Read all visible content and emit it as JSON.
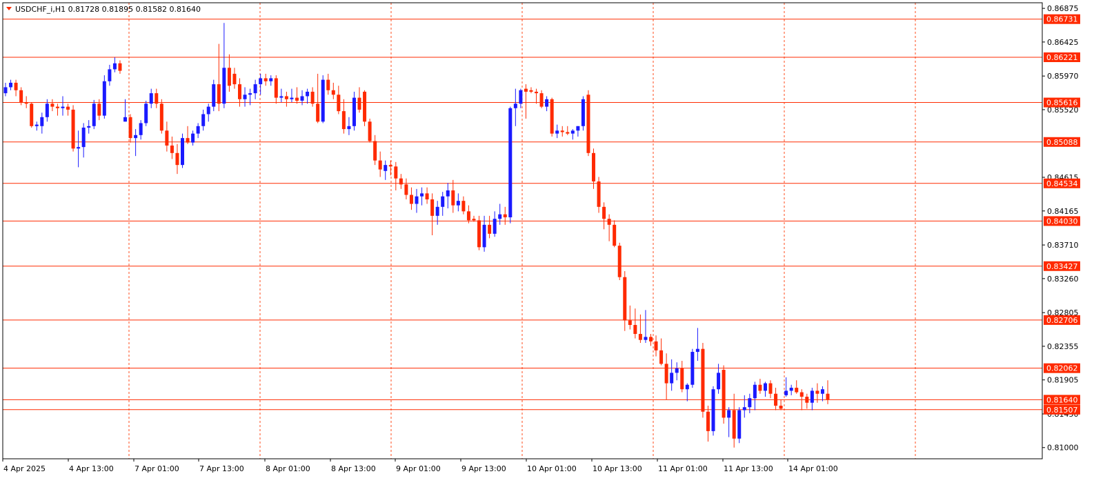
{
  "chart_header": {
    "symbol": "USDCHF_i,H1",
    "ohlc": "0.81728 0.81895 0.81582 0.81640",
    "text": "USDCHF_i,H1  0.81728 0.81895 0.81582 0.81640"
  },
  "colors": {
    "bull": "#1a1aff",
    "bear": "#ff2a00",
    "hline": "#ff2a00",
    "vgrid": "#ff4a1a",
    "label_bg": "#ff2a00",
    "label_text": "#ffffff",
    "frame": "#000000"
  },
  "chart_data": {
    "type": "candlestick",
    "title": "USDCHF_i,H1",
    "ylim": [
      0.8085,
      0.8695
    ],
    "price_axis_ticks": [
      "0.86875",
      "0.86425",
      "0.85970",
      "0.85520",
      "0.84615",
      "0.84165",
      "0.83710",
      "0.83260",
      "0.82805",
      "0.82355",
      "0.81905",
      "0.81450",
      "0.81000"
    ],
    "time_axis_ticks": [
      "4 Apr 2025",
      "4 Apr 13:00",
      "7 Apr 01:00",
      "7 Apr 13:00",
      "8 Apr 01:00",
      "8 Apr 13:00",
      "9 Apr 01:00",
      "9 Apr 13:00",
      "10 Apr 01:00",
      "10 Apr 13:00",
      "11 Apr 01:00",
      "11 Apr 13:00",
      "14 Apr 01:00"
    ],
    "horizontal_levels": [
      "0.86731",
      "0.86221",
      "0.85616",
      "0.85088",
      "0.84534",
      "0.84030",
      "0.83427",
      "0.82706",
      "0.82062",
      "0.81640",
      "0.81507"
    ],
    "current_price": "0.81640",
    "candles": [
      [
        0.8574,
        0.8588,
        0.857,
        0.8582
      ],
      [
        0.8582,
        0.8592,
        0.8578,
        0.8588
      ],
      [
        0.8588,
        0.8592,
        0.857,
        0.8578
      ],
      [
        0.8578,
        0.8582,
        0.8558,
        0.8562
      ],
      [
        0.8562,
        0.857,
        0.8554,
        0.856
      ],
      [
        0.856,
        0.8562,
        0.8528,
        0.853
      ],
      [
        0.853,
        0.8536,
        0.8524,
        0.8532
      ],
      [
        0.853,
        0.8548,
        0.852,
        0.8542
      ],
      [
        0.8542,
        0.8566,
        0.8536,
        0.856
      ],
      [
        0.856,
        0.8566,
        0.855,
        0.8556
      ],
      [
        0.8556,
        0.856,
        0.8544,
        0.8554
      ],
      [
        0.8554,
        0.857,
        0.8544,
        0.8556
      ],
      [
        0.8556,
        0.856,
        0.8544,
        0.8552
      ],
      [
        0.8552,
        0.8558,
        0.8496,
        0.85
      ],
      [
        0.85,
        0.8524,
        0.8475,
        0.8502
      ],
      [
        0.8502,
        0.8534,
        0.8488,
        0.8528
      ],
      [
        0.8528,
        0.8538,
        0.852,
        0.853
      ],
      [
        0.853,
        0.8565,
        0.8526,
        0.856
      ],
      [
        0.856,
        0.8566,
        0.8538,
        0.8544
      ],
      [
        0.8544,
        0.8598,
        0.854,
        0.859
      ],
      [
        0.859,
        0.8612,
        0.8584,
        0.8606
      ],
      [
        0.8606,
        0.8622,
        0.8602,
        0.8614
      ],
      [
        0.8614,
        0.8618,
        0.86,
        0.8604
      ],
      [
        0.8536,
        0.8566,
        0.8536,
        0.8542
      ],
      [
        0.8542,
        0.8546,
        0.8508,
        0.8514
      ],
      [
        0.8514,
        0.8526,
        0.849,
        0.8518
      ],
      [
        0.8518,
        0.8538,
        0.8512,
        0.8534
      ],
      [
        0.8534,
        0.8564,
        0.853,
        0.856
      ],
      [
        0.856,
        0.858,
        0.8554,
        0.8574
      ],
      [
        0.8574,
        0.858,
        0.8554,
        0.856
      ],
      [
        0.856,
        0.8566,
        0.852,
        0.8524
      ],
      [
        0.8524,
        0.8536,
        0.8496,
        0.8504
      ],
      [
        0.8504,
        0.8516,
        0.8486,
        0.8494
      ],
      [
        0.8494,
        0.8506,
        0.8466,
        0.8478
      ],
      [
        0.8478,
        0.852,
        0.8474,
        0.8514
      ],
      [
        0.8514,
        0.853,
        0.8506,
        0.8508
      ],
      [
        0.8508,
        0.8524,
        0.8504,
        0.852
      ],
      [
        0.852,
        0.8534,
        0.8514,
        0.853
      ],
      [
        0.853,
        0.8552,
        0.8524,
        0.8546
      ],
      [
        0.8546,
        0.856,
        0.8536,
        0.8556
      ],
      [
        0.8556,
        0.8592,
        0.855,
        0.8586
      ],
      [
        0.8586,
        0.864,
        0.855,
        0.856
      ],
      [
        0.856,
        0.8668,
        0.8554,
        0.8608
      ],
      [
        0.8608,
        0.8626,
        0.8576,
        0.8584
      ],
      [
        0.86,
        0.8608,
        0.858,
        0.8586
      ],
      [
        0.8586,
        0.8594,
        0.8556,
        0.8566
      ],
      [
        0.8566,
        0.8582,
        0.8556,
        0.8572
      ],
      [
        0.8572,
        0.858,
        0.8558,
        0.8574
      ],
      [
        0.8574,
        0.8592,
        0.8566,
        0.8586
      ],
      [
        0.8586,
        0.86,
        0.8572,
        0.8594
      ],
      [
        0.8594,
        0.86,
        0.8584,
        0.859
      ],
      [
        0.859,
        0.8598,
        0.8584,
        0.8594
      ],
      [
        0.8594,
        0.8598,
        0.856,
        0.8568
      ],
      [
        0.8568,
        0.858,
        0.8562,
        0.857
      ],
      [
        0.857,
        0.8576,
        0.8556,
        0.8566
      ],
      [
        0.8566,
        0.858,
        0.8562,
        0.8568
      ],
      [
        0.8568,
        0.8582,
        0.856,
        0.8564
      ],
      [
        0.8564,
        0.8578,
        0.8558,
        0.857
      ],
      [
        0.857,
        0.858,
        0.856,
        0.8576
      ],
      [
        0.8576,
        0.8582,
        0.8556,
        0.856
      ],
      [
        0.856,
        0.86,
        0.8534,
        0.8536
      ],
      [
        0.8536,
        0.8598,
        0.8534,
        0.8592
      ],
      [
        0.8592,
        0.86,
        0.8572,
        0.8578
      ],
      [
        0.8578,
        0.8588,
        0.8566,
        0.8572
      ],
      [
        0.8572,
        0.8584,
        0.8546,
        0.855
      ],
      [
        0.855,
        0.8566,
        0.852,
        0.8526
      ],
      [
        0.8526,
        0.8542,
        0.8518,
        0.853
      ],
      [
        0.853,
        0.8576,
        0.8524,
        0.8568
      ],
      [
        0.8568,
        0.8582,
        0.8548,
        0.8552
      ],
      [
        0.8576,
        0.8578,
        0.853,
        0.8536
      ],
      [
        0.8536,
        0.854,
        0.8508,
        0.851
      ],
      [
        0.851,
        0.8518,
        0.8478,
        0.8484
      ],
      [
        0.8484,
        0.8496,
        0.8462,
        0.8472
      ],
      [
        0.847,
        0.8484,
        0.8458,
        0.8478
      ],
      [
        0.8478,
        0.8484,
        0.8464,
        0.8476
      ],
      [
        0.8476,
        0.8482,
        0.8444,
        0.846
      ],
      [
        0.846,
        0.8466,
        0.8446,
        0.8452
      ],
      [
        0.8452,
        0.846,
        0.8432,
        0.8438
      ],
      [
        0.8438,
        0.8448,
        0.8418,
        0.8426
      ],
      [
        0.8426,
        0.8446,
        0.8414,
        0.8436
      ],
      [
        0.8436,
        0.8448,
        0.8424,
        0.844
      ],
      [
        0.844,
        0.8448,
        0.8426,
        0.8432
      ],
      [
        0.8432,
        0.844,
        0.8384,
        0.841
      ],
      [
        0.841,
        0.843,
        0.8398,
        0.8422
      ],
      [
        0.8422,
        0.8442,
        0.841,
        0.8436
      ],
      [
        0.8436,
        0.8454,
        0.842,
        0.8444
      ],
      [
        0.8444,
        0.8458,
        0.8414,
        0.8424
      ],
      [
        0.8424,
        0.844,
        0.8416,
        0.843
      ],
      [
        0.843,
        0.8436,
        0.8412,
        0.8416
      ],
      [
        0.8416,
        0.8424,
        0.84,
        0.8404
      ],
      [
        0.8406,
        0.841,
        0.8402,
        0.8404
      ],
      [
        0.8404,
        0.841,
        0.8364,
        0.8368
      ],
      [
        0.8368,
        0.841,
        0.8362,
        0.8398
      ],
      [
        0.8398,
        0.841,
        0.838,
        0.8386
      ],
      [
        0.8386,
        0.8416,
        0.8382,
        0.8406
      ],
      [
        0.8406,
        0.8426,
        0.8398,
        0.8412
      ],
      [
        0.8412,
        0.8422,
        0.8398,
        0.8408
      ],
      [
        0.8408,
        0.8556,
        0.84,
        0.8554
      ],
      [
        0.8554,
        0.858,
        0.853,
        0.856
      ],
      [
        0.856,
        0.858,
        0.8554,
        0.8578
      ],
      [
        0.858,
        0.8586,
        0.854,
        0.8576
      ],
      [
        0.8578,
        0.8582,
        0.8574,
        0.8576
      ],
      [
        0.8576,
        0.858,
        0.856,
        0.8574
      ],
      [
        0.8574,
        0.8578,
        0.8554,
        0.8556
      ],
      [
        0.8556,
        0.857,
        0.855,
        0.8566
      ],
      [
        0.8566,
        0.8568,
        0.8516,
        0.852
      ],
      [
        0.852,
        0.8532,
        0.8514,
        0.8524
      ],
      [
        0.8524,
        0.853,
        0.8516,
        0.8522
      ],
      [
        0.8522,
        0.853,
        0.8518,
        0.852
      ],
      [
        0.852,
        0.8526,
        0.8512,
        0.8524
      ],
      [
        0.8524,
        0.853,
        0.8516,
        0.853
      ],
      [
        0.853,
        0.857,
        0.8524,
        0.8566
      ],
      [
        0.8572,
        0.8578,
        0.849,
        0.8494
      ],
      [
        0.8494,
        0.85,
        0.8446,
        0.8456
      ],
      [
        0.8456,
        0.8462,
        0.8414,
        0.8422
      ],
      [
        0.8422,
        0.8428,
        0.8392,
        0.8406
      ],
      [
        0.8406,
        0.8412,
        0.8376,
        0.8398
      ],
      [
        0.8398,
        0.8404,
        0.8368,
        0.837
      ],
      [
        0.837,
        0.8374,
        0.8324,
        0.8328
      ],
      [
        0.8328,
        0.8336,
        0.8256,
        0.827
      ],
      [
        0.827,
        0.829,
        0.8258,
        0.8264
      ],
      [
        0.8264,
        0.8286,
        0.8246,
        0.8252
      ],
      [
        0.8252,
        0.8278,
        0.824,
        0.8244
      ],
      [
        0.8244,
        0.8284,
        0.824,
        0.8248
      ],
      [
        0.8248,
        0.8252,
        0.8236,
        0.8242
      ],
      [
        0.8242,
        0.825,
        0.8222,
        0.823
      ],
      [
        0.823,
        0.8246,
        0.821,
        0.8212
      ],
      [
        0.8212,
        0.8226,
        0.8164,
        0.8186
      ],
      [
        0.8186,
        0.8218,
        0.8176,
        0.82
      ],
      [
        0.82,
        0.8214,
        0.819,
        0.8206
      ],
      [
        0.8206,
        0.8216,
        0.8174,
        0.8178
      ],
      [
        0.8178,
        0.8186,
        0.8162,
        0.8184
      ],
      [
        0.8184,
        0.8232,
        0.818,
        0.8228
      ],
      [
        0.8228,
        0.826,
        0.8216,
        0.8232
      ],
      [
        0.8232,
        0.824,
        0.814,
        0.8148
      ],
      [
        0.8148,
        0.8156,
        0.8108,
        0.8122
      ],
      [
        0.8122,
        0.8182,
        0.8116,
        0.8178
      ],
      [
        0.8178,
        0.8212,
        0.8172,
        0.82
      ],
      [
        0.8204,
        0.821,
        0.8132,
        0.814
      ],
      [
        0.814,
        0.8154,
        0.8114,
        0.815
      ],
      [
        0.815,
        0.8172,
        0.81,
        0.8112
      ],
      [
        0.8112,
        0.8154,
        0.8106,
        0.815
      ],
      [
        0.815,
        0.817,
        0.814,
        0.8154
      ],
      [
        0.8154,
        0.8172,
        0.8146,
        0.8166
      ],
      [
        0.8166,
        0.8188,
        0.815,
        0.8184
      ],
      [
        0.8184,
        0.8192,
        0.8172,
        0.8176
      ],
      [
        0.8176,
        0.8188,
        0.8168,
        0.8186
      ],
      [
        0.8186,
        0.819,
        0.8166,
        0.8172
      ],
      [
        0.8172,
        0.818,
        0.815,
        0.8156
      ],
      [
        0.8156,
        0.8164,
        0.815,
        0.8152
      ],
      [
        0.817,
        0.8194,
        0.8168,
        0.8176
      ],
      [
        0.8176,
        0.8184,
        0.817,
        0.818
      ],
      [
        0.818,
        0.819,
        0.8172,
        0.8174
      ],
      [
        0.8174,
        0.8178,
        0.815,
        0.8168
      ],
      [
        0.8168,
        0.8172,
        0.8152,
        0.816
      ],
      [
        0.816,
        0.818,
        0.815,
        0.8176
      ],
      [
        0.8176,
        0.8186,
        0.816,
        0.8172
      ],
      [
        0.8172,
        0.8182,
        0.8162,
        0.8178
      ],
      [
        0.8172,
        0.819,
        0.8158,
        0.8164
      ]
    ]
  }
}
